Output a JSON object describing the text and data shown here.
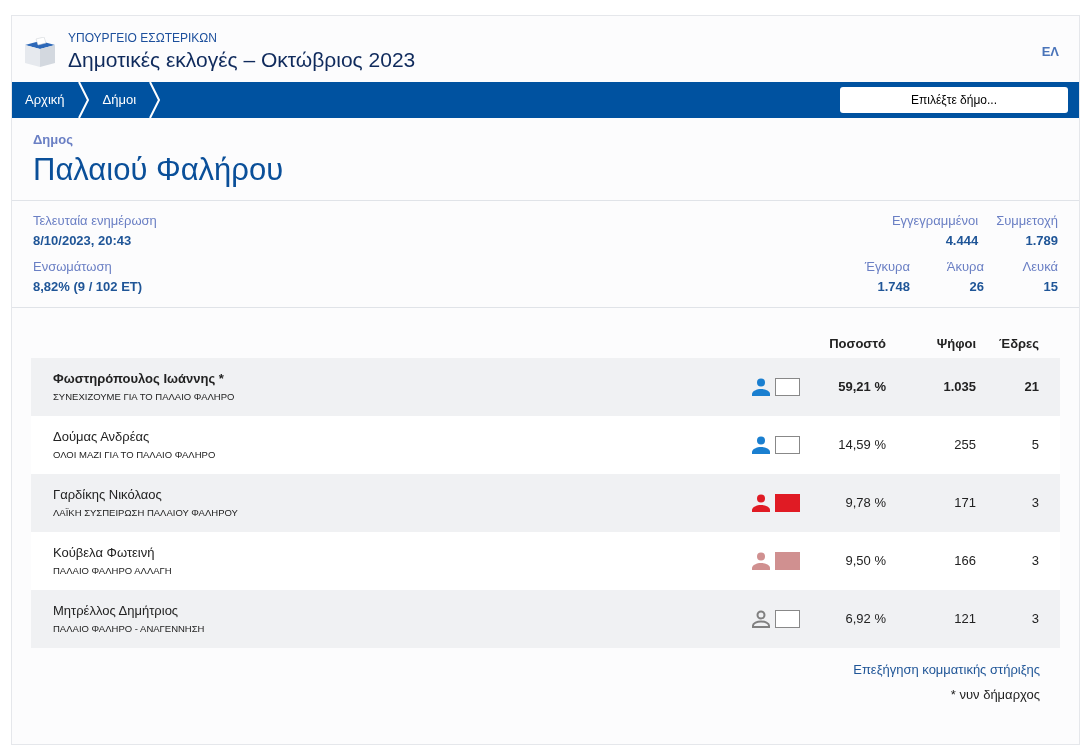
{
  "header": {
    "ministry": "ΥΠΟΥΡΓΕΙΟ ΕΣΩΤΕΡΙΚΩΝ",
    "title": "Δημοτικές εκλογές – Οκτώβριος 2023",
    "language": "ΕΛ"
  },
  "breadcrumbs": [
    "Αρχική",
    "Δήμοι"
  ],
  "municipality_select": {
    "placeholder": "Επιλέξτε δήμο..."
  },
  "municipality": {
    "label": "Δημος",
    "name": "Παλαιού Φαλήρου"
  },
  "info_left": [
    {
      "label": "Τελευταία ενημέρωση",
      "value": "8/10/2023, 20:43"
    },
    {
      "label": "Ενσωμάτωση",
      "value": "8,82% (9 / 102 ΕΤ)"
    }
  ],
  "stats_rows": [
    [
      {
        "label": "Εγγεγραμμένοι",
        "value": "4.444"
      },
      {
        "label": "Συμμετοχή",
        "value": "1.789"
      }
    ],
    [
      {
        "label": "Έγκυρα",
        "value": "1.748"
      },
      {
        "label": "Άκυρα",
        "value": "26"
      },
      {
        "label": "Λευκά",
        "value": "15"
      }
    ]
  ],
  "results": {
    "columns": [
      "Ποσοστό",
      "Ψήφοι",
      "Έδρες"
    ],
    "rows": [
      {
        "candidate": "Φωστηρόπουλος Ιωάννης *",
        "party": "ΣΥΝΕΧΙΖΟΥΜΕ ΓΙΑ ΤΟ ΠΑΛΑΙΟ ΦΑΛΗΡΟ",
        "leading": true,
        "kind": "filled",
        "color": "#1a7fd0",
        "swatch": {
          "color": "#ffffff"
        },
        "percent": "59,21 %",
        "votes": "1.035",
        "seats": "21"
      },
      {
        "candidate": "Δούμας Ανδρέας",
        "party": "ΟΛΟΙ ΜΑΖΙ ΓΙΑ ΤΟ ΠΑΛΑΙΟ ΦΑΛΗΡΟ",
        "leading": false,
        "kind": "filled",
        "color": "#1a7fd0",
        "swatch": {
          "color": "#ffffff"
        },
        "percent": "14,59 %",
        "votes": "255",
        "seats": "5"
      },
      {
        "candidate": "Γαρδίκης Νικόλαος",
        "party": "ΛΑΪΚΗ ΣΥΣΠΕΙΡΩΣΗ ΠΑΛΑΙΟΥ ΦΑΛΗΡΟΥ",
        "leading": false,
        "kind": "filled",
        "color": "#e01b24",
        "swatch": {
          "color": "#e01b24"
        },
        "percent": "9,78 %",
        "votes": "171",
        "seats": "3"
      },
      {
        "candidate": "Κούβελα Φωτεινή",
        "party": "ΠΑΛΑΙΟ ΦΑΛΗΡΟ ΑΛΛΑΓΗ",
        "leading": false,
        "kind": "filled",
        "color": "#d09090",
        "swatch": {
          "color": "#d09090"
        },
        "percent": "9,50 %",
        "votes": "166",
        "seats": "3"
      },
      {
        "candidate": "Μητρέλλος Δημήτριος",
        "party": "ΠΑΛΑΙΟ ΦΑΛΗΡΟ - ΑΝΑΓΕΝΝΗΣΗ",
        "leading": false,
        "kind": "outline",
        "color": "#808080",
        "swatch": {
          "color": "#ffffff"
        },
        "percent": "6,92 %",
        "votes": "121",
        "seats": "3"
      }
    ]
  },
  "support_link": "Επεξήγηση κομματικής στήριξης",
  "footnote": "* νυν δήμαρχος"
}
